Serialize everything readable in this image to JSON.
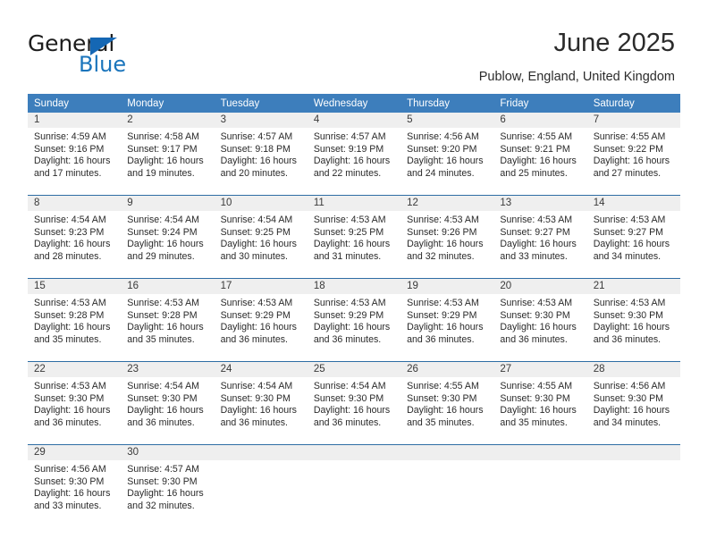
{
  "brand": {
    "name_top": "General",
    "name_bottom": "Blue",
    "triangle_color": "#1567b4",
    "blue_text_color": "#1b75bc"
  },
  "header": {
    "title": "June 2025",
    "location": "Publow, England, United Kingdom"
  },
  "theme": {
    "header_row_bg": "#3d7ebc",
    "row_divider": "#2e6da4",
    "day_band_bg": "#efefef"
  },
  "weekdays": [
    "Sunday",
    "Monday",
    "Tuesday",
    "Wednesday",
    "Thursday",
    "Friday",
    "Saturday"
  ],
  "weeks": [
    [
      {
        "day": "1",
        "sunrise": "Sunrise: 4:59 AM",
        "sunset": "Sunset: 9:16 PM",
        "daylight1": "Daylight: 16 hours",
        "daylight2": "and 17 minutes."
      },
      {
        "day": "2",
        "sunrise": "Sunrise: 4:58 AM",
        "sunset": "Sunset: 9:17 PM",
        "daylight1": "Daylight: 16 hours",
        "daylight2": "and 19 minutes."
      },
      {
        "day": "3",
        "sunrise": "Sunrise: 4:57 AM",
        "sunset": "Sunset: 9:18 PM",
        "daylight1": "Daylight: 16 hours",
        "daylight2": "and 20 minutes."
      },
      {
        "day": "4",
        "sunrise": "Sunrise: 4:57 AM",
        "sunset": "Sunset: 9:19 PM",
        "daylight1": "Daylight: 16 hours",
        "daylight2": "and 22 minutes."
      },
      {
        "day": "5",
        "sunrise": "Sunrise: 4:56 AM",
        "sunset": "Sunset: 9:20 PM",
        "daylight1": "Daylight: 16 hours",
        "daylight2": "and 24 minutes."
      },
      {
        "day": "6",
        "sunrise": "Sunrise: 4:55 AM",
        "sunset": "Sunset: 9:21 PM",
        "daylight1": "Daylight: 16 hours",
        "daylight2": "and 25 minutes."
      },
      {
        "day": "7",
        "sunrise": "Sunrise: 4:55 AM",
        "sunset": "Sunset: 9:22 PM",
        "daylight1": "Daylight: 16 hours",
        "daylight2": "and 27 minutes."
      }
    ],
    [
      {
        "day": "8",
        "sunrise": "Sunrise: 4:54 AM",
        "sunset": "Sunset: 9:23 PM",
        "daylight1": "Daylight: 16 hours",
        "daylight2": "and 28 minutes."
      },
      {
        "day": "9",
        "sunrise": "Sunrise: 4:54 AM",
        "sunset": "Sunset: 9:24 PM",
        "daylight1": "Daylight: 16 hours",
        "daylight2": "and 29 minutes."
      },
      {
        "day": "10",
        "sunrise": "Sunrise: 4:54 AM",
        "sunset": "Sunset: 9:25 PM",
        "daylight1": "Daylight: 16 hours",
        "daylight2": "and 30 minutes."
      },
      {
        "day": "11",
        "sunrise": "Sunrise: 4:53 AM",
        "sunset": "Sunset: 9:25 PM",
        "daylight1": "Daylight: 16 hours",
        "daylight2": "and 31 minutes."
      },
      {
        "day": "12",
        "sunrise": "Sunrise: 4:53 AM",
        "sunset": "Sunset: 9:26 PM",
        "daylight1": "Daylight: 16 hours",
        "daylight2": "and 32 minutes."
      },
      {
        "day": "13",
        "sunrise": "Sunrise: 4:53 AM",
        "sunset": "Sunset: 9:27 PM",
        "daylight1": "Daylight: 16 hours",
        "daylight2": "and 33 minutes."
      },
      {
        "day": "14",
        "sunrise": "Sunrise: 4:53 AM",
        "sunset": "Sunset: 9:27 PM",
        "daylight1": "Daylight: 16 hours",
        "daylight2": "and 34 minutes."
      }
    ],
    [
      {
        "day": "15",
        "sunrise": "Sunrise: 4:53 AM",
        "sunset": "Sunset: 9:28 PM",
        "daylight1": "Daylight: 16 hours",
        "daylight2": "and 35 minutes."
      },
      {
        "day": "16",
        "sunrise": "Sunrise: 4:53 AM",
        "sunset": "Sunset: 9:28 PM",
        "daylight1": "Daylight: 16 hours",
        "daylight2": "and 35 minutes."
      },
      {
        "day": "17",
        "sunrise": "Sunrise: 4:53 AM",
        "sunset": "Sunset: 9:29 PM",
        "daylight1": "Daylight: 16 hours",
        "daylight2": "and 36 minutes."
      },
      {
        "day": "18",
        "sunrise": "Sunrise: 4:53 AM",
        "sunset": "Sunset: 9:29 PM",
        "daylight1": "Daylight: 16 hours",
        "daylight2": "and 36 minutes."
      },
      {
        "day": "19",
        "sunrise": "Sunrise: 4:53 AM",
        "sunset": "Sunset: 9:29 PM",
        "daylight1": "Daylight: 16 hours",
        "daylight2": "and 36 minutes."
      },
      {
        "day": "20",
        "sunrise": "Sunrise: 4:53 AM",
        "sunset": "Sunset: 9:30 PM",
        "daylight1": "Daylight: 16 hours",
        "daylight2": "and 36 minutes."
      },
      {
        "day": "21",
        "sunrise": "Sunrise: 4:53 AM",
        "sunset": "Sunset: 9:30 PM",
        "daylight1": "Daylight: 16 hours",
        "daylight2": "and 36 minutes."
      }
    ],
    [
      {
        "day": "22",
        "sunrise": "Sunrise: 4:53 AM",
        "sunset": "Sunset: 9:30 PM",
        "daylight1": "Daylight: 16 hours",
        "daylight2": "and 36 minutes."
      },
      {
        "day": "23",
        "sunrise": "Sunrise: 4:54 AM",
        "sunset": "Sunset: 9:30 PM",
        "daylight1": "Daylight: 16 hours",
        "daylight2": "and 36 minutes."
      },
      {
        "day": "24",
        "sunrise": "Sunrise: 4:54 AM",
        "sunset": "Sunset: 9:30 PM",
        "daylight1": "Daylight: 16 hours",
        "daylight2": "and 36 minutes."
      },
      {
        "day": "25",
        "sunrise": "Sunrise: 4:54 AM",
        "sunset": "Sunset: 9:30 PM",
        "daylight1": "Daylight: 16 hours",
        "daylight2": "and 36 minutes."
      },
      {
        "day": "26",
        "sunrise": "Sunrise: 4:55 AM",
        "sunset": "Sunset: 9:30 PM",
        "daylight1": "Daylight: 16 hours",
        "daylight2": "and 35 minutes."
      },
      {
        "day": "27",
        "sunrise": "Sunrise: 4:55 AM",
        "sunset": "Sunset: 9:30 PM",
        "daylight1": "Daylight: 16 hours",
        "daylight2": "and 35 minutes."
      },
      {
        "day": "28",
        "sunrise": "Sunrise: 4:56 AM",
        "sunset": "Sunset: 9:30 PM",
        "daylight1": "Daylight: 16 hours",
        "daylight2": "and 34 minutes."
      }
    ],
    [
      {
        "day": "29",
        "sunrise": "Sunrise: 4:56 AM",
        "sunset": "Sunset: 9:30 PM",
        "daylight1": "Daylight: 16 hours",
        "daylight2": "and 33 minutes."
      },
      {
        "day": "30",
        "sunrise": "Sunrise: 4:57 AM",
        "sunset": "Sunset: 9:30 PM",
        "daylight1": "Daylight: 16 hours",
        "daylight2": "and 32 minutes."
      },
      {
        "day": "",
        "sunrise": "",
        "sunset": "",
        "daylight1": "",
        "daylight2": ""
      },
      {
        "day": "",
        "sunrise": "",
        "sunset": "",
        "daylight1": "",
        "daylight2": ""
      },
      {
        "day": "",
        "sunrise": "",
        "sunset": "",
        "daylight1": "",
        "daylight2": ""
      },
      {
        "day": "",
        "sunrise": "",
        "sunset": "",
        "daylight1": "",
        "daylight2": ""
      },
      {
        "day": "",
        "sunrise": "",
        "sunset": "",
        "daylight1": "",
        "daylight2": ""
      }
    ]
  ]
}
